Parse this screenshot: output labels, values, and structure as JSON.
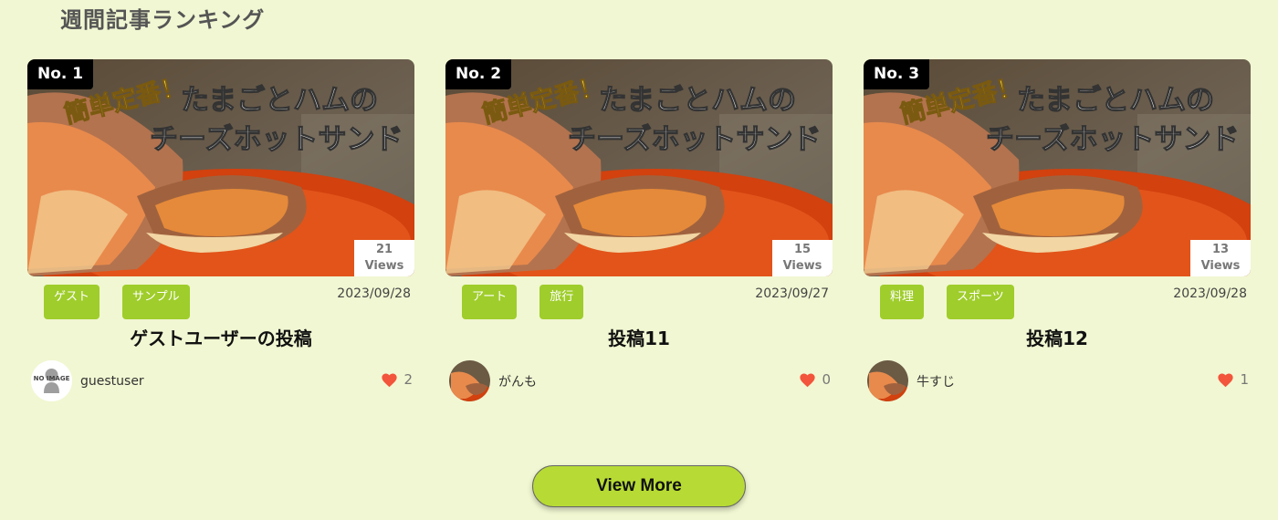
{
  "section": {
    "title": "週間記事ランキング"
  },
  "thumbnail": {
    "line1": "簡単定番！",
    "line2": "たまごとハムの",
    "line3": "チーズホットサンド"
  },
  "cards": [
    {
      "rank": "No. 1",
      "views_count": "21",
      "views_label": "Views",
      "tags": [
        "ゲスト",
        "サンプル"
      ],
      "date": "2023/09/28",
      "title": "ゲストユーザーの投稿",
      "author": "guestuser",
      "avatar_text": "NO IMAGE",
      "likes": "2"
    },
    {
      "rank": "No. 2",
      "views_count": "15",
      "views_label": "Views",
      "tags": [
        "アート",
        "旅行"
      ],
      "date": "2023/09/27",
      "title": "投稿11",
      "author": "がんも",
      "likes": "0"
    },
    {
      "rank": "No. 3",
      "views_count": "13",
      "views_label": "Views",
      "tags": [
        "料理",
        "スポーツ"
      ],
      "date": "2023/09/28",
      "title": "投稿12",
      "author": "牛すじ",
      "likes": "1"
    }
  ],
  "view_more_label": "View More",
  "icons": {
    "like": "heart-icon"
  },
  "colors": {
    "background": "#f1f7d2",
    "tag": "#9fcd2b",
    "button": "#b7db34",
    "heart": "#f2553b"
  }
}
